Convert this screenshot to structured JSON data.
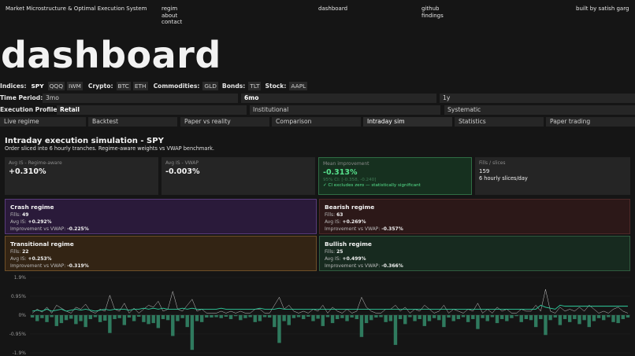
{
  "nav": {
    "site_title": "Market Microstructure & Optimal Execution System",
    "links_col1": [
      "regim",
      "about",
      "contact"
    ],
    "center": "dashboard",
    "links_col3": [
      "github",
      "findings"
    ],
    "credit": "built by satish garg"
  },
  "hero": "dashboard",
  "indices": {
    "label": "Indices:",
    "items": [
      "SPY",
      "QQQ",
      "IWM"
    ],
    "selected": "SPY",
    "crypto_label": "Crypto:",
    "crypto": [
      "BTC",
      "ETH"
    ],
    "commodities_label": "Commodities:",
    "commodities": [
      "GLD"
    ],
    "bonds_label": "Bonds:",
    "bonds": [
      "TLT"
    ],
    "stock_label": "Stock:",
    "stock": [
      "AAPL"
    ]
  },
  "time_period": {
    "label": "Time Period:",
    "options": [
      "3mo",
      "6mo",
      "1y"
    ],
    "selected": "6mo"
  },
  "execution_profile": {
    "label": "Execution Profile:",
    "options": [
      "Retail",
      "Institutional",
      "Systematic"
    ],
    "selected": "Retail"
  },
  "tabs": [
    "Live regime",
    "Backtest",
    "Paper vs reality",
    "Comparison",
    "Intraday sim",
    "Statistics",
    "Paper trading"
  ],
  "selected_tab": "Intraday sim",
  "section": {
    "title": "Intraday execution simulation - SPY",
    "subtitle": "Order sliced into 6 hourly tranches. Regime-aware weights vs VWAP benchmark."
  },
  "cards": {
    "c1": {
      "k": "Avg IS - Regime-aware",
      "v": "+0.310%"
    },
    "c2": {
      "k": "Avg IS - VWAP",
      "v": "-0.003%"
    },
    "c3": {
      "k": "Mean improvement",
      "v": "-0.313%",
      "ci": "95% CI: [-0.358, -0.240]",
      "sig": "✓ CI excludes zero — statistically significant"
    },
    "c4": {
      "k": "Fills / slices",
      "v": "159",
      "s": "6 hourly slices/day"
    }
  },
  "regimes": {
    "crash": {
      "title": "Crash regime",
      "fills_label": "Fills:",
      "fills": "49",
      "avg_label": "Avg IS:",
      "avg": "+0.292%",
      "imp_label": "Improvement vs VWAP:",
      "imp": "-0.225%"
    },
    "bear": {
      "title": "Bearish regime",
      "fills_label": "Fills:",
      "fills": "63",
      "avg_label": "Avg IS:",
      "avg": "+0.269%",
      "imp_label": "Improvement vs VWAP:",
      "imp": "-0.357%"
    },
    "trans": {
      "title": "Transitional regime",
      "fills_label": "Fills:",
      "fills": "22",
      "avg_label": "Avg IS:",
      "avg": "+0.253%",
      "imp_label": "Improvement vs VWAP:",
      "imp": "-0.319%"
    },
    "bull": {
      "title": "Bullish regime",
      "fills_label": "Fills:",
      "fills": "25",
      "avg_label": "Avg IS:",
      "avg": "+0.499%",
      "imp_label": "Improvement vs VWAP:",
      "imp": "-0.366%"
    }
  },
  "colors": {
    "bar": "#2f7a5e",
    "line": "#2fd0a0",
    "thin": "#c8c8c8"
  },
  "chart_data": {
    "type": "bar",
    "ytick_labels": [
      "1.9%",
      "0.95%",
      "0%",
      "-0.95%",
      "-1.9%"
    ],
    "yticks": [
      1.9,
      0.95,
      0,
      -0.95,
      -1.9
    ],
    "ylim": [
      -1.9,
      1.9
    ],
    "series": [
      {
        "values": [
          -0.12,
          -0.3,
          -0.15,
          -0.35,
          -0.1,
          -0.55,
          -0.4,
          -0.25,
          -0.18,
          -0.45,
          -0.3,
          -0.6,
          -0.2,
          -0.1,
          -0.35,
          -0.28,
          -0.9,
          -0.2,
          -0.15,
          -0.5,
          -0.12,
          -0.3,
          -0.08,
          -0.35,
          -0.45,
          -0.4,
          -0.65,
          -0.2,
          -0.25,
          -1.05,
          -0.3,
          -0.15,
          -0.6,
          -1.75,
          -0.3,
          -0.35,
          -0.12,
          -0.12,
          -0.1,
          -0.15,
          -0.08,
          -0.2,
          -0.05,
          -0.25,
          -0.15,
          -0.1,
          -0.35,
          -0.3,
          -0.1,
          -0.12,
          -0.6,
          -1.4,
          -0.3,
          -0.5,
          -0.15,
          -0.1,
          -0.2,
          -0.08,
          -0.3,
          -0.18,
          -0.55,
          -0.1,
          -0.4,
          -0.2,
          -0.15,
          -0.3,
          -0.12,
          -0.2,
          -1.1,
          -0.4,
          -0.25,
          -0.12,
          -0.1,
          -0.35,
          -0.3,
          -1.5,
          -0.2,
          -0.45,
          -0.1,
          -0.3,
          -0.2,
          -0.55,
          -0.3,
          -0.15,
          -0.25,
          -0.6,
          -0.12,
          -0.3,
          -0.2,
          -0.1,
          -0.35,
          -0.2,
          -0.7,
          -0.15,
          -0.3,
          -0.1,
          -0.4,
          -0.2,
          -0.3,
          -0.15,
          -0.05,
          -0.35,
          -0.2,
          -0.25,
          -0.6,
          -0.2,
          -1.0,
          -0.25,
          -0.12,
          -0.5,
          -0.2,
          -0.35,
          -0.2,
          -0.45,
          -0.25,
          -0.6,
          -0.3,
          -0.15,
          -0.25,
          -0.1,
          -0.35,
          -0.4,
          -0.2,
          -0.12
        ]
      }
    ],
    "line": [
      0.2,
      0.25,
      0.2,
      0.3,
      0.2,
      0.25,
      0.3,
      0.2,
      0.25,
      0.3,
      0.25,
      0.3,
      0.25,
      0.2,
      0.25,
      0.3,
      0.25,
      0.3,
      0.3,
      0.3,
      0.25,
      0.3,
      0.3,
      0.35,
      0.3,
      0.35,
      0.3,
      0.35,
      0.3,
      0.3,
      0.3,
      0.35,
      0.3,
      0.35,
      0.3,
      0.3,
      0.3,
      0.3,
      0.3,
      0.35,
      0.3,
      0.3,
      0.3,
      0.3,
      0.3,
      0.3,
      0.3,
      0.35,
      0.3,
      0.3,
      0.3,
      0.35,
      0.3,
      0.3,
      0.3,
      0.3,
      0.3,
      0.3,
      0.3,
      0.3,
      0.3,
      0.3,
      0.3,
      0.3,
      0.3,
      0.3,
      0.3,
      0.3,
      0.3,
      0.3,
      0.3,
      0.3,
      0.3,
      0.3,
      0.3,
      0.3,
      0.3,
      0.3,
      0.3,
      0.3,
      0.3,
      0.3,
      0.3,
      0.3,
      0.3,
      0.3,
      0.3,
      0.3,
      0.3,
      0.3,
      0.3,
      0.3,
      0.3,
      0.3,
      0.3,
      0.3,
      0.3,
      0.3,
      0.3,
      0.3,
      0.3,
      0.3,
      0.3,
      0.3,
      0.3,
      0.5,
      0.4,
      0.35,
      0.3,
      0.5,
      0.45,
      0.45,
      0.45,
      0.45,
      0.45,
      0.45,
      0.45,
      0.45,
      0.45,
      0.45,
      0.45,
      0.45,
      0.45,
      0.45
    ],
    "thin": [
      0.1,
      0.3,
      0.15,
      0.4,
      0.1,
      0.5,
      0.35,
      0.2,
      0.1,
      0.4,
      0.3,
      0.55,
      0.2,
      0.1,
      0.3,
      0.2,
      1.0,
      0.3,
      0.2,
      0.6,
      0.1,
      0.35,
      0.1,
      0.3,
      0.5,
      0.4,
      0.7,
      0.2,
      0.3,
      1.2,
      0.3,
      0.2,
      0.5,
      0.8,
      0.2,
      0.3,
      0.1,
      0.1,
      0.1,
      0.2,
      0.1,
      0.2,
      0.1,
      0.2,
      0.1,
      0.1,
      0.3,
      0.3,
      0.1,
      0.1,
      0.5,
      0.9,
      0.3,
      0.5,
      0.2,
      0.1,
      0.2,
      0.1,
      0.3,
      0.2,
      0.5,
      0.1,
      0.4,
      0.2,
      0.1,
      0.3,
      0.1,
      0.2,
      0.9,
      0.4,
      0.2,
      0.1,
      0.1,
      0.3,
      0.3,
      0.5,
      0.2,
      0.4,
      0.1,
      0.3,
      0.2,
      0.5,
      0.3,
      0.1,
      0.2,
      0.5,
      0.1,
      0.3,
      0.2,
      0.1,
      0.3,
      0.2,
      0.6,
      0.1,
      0.3,
      0.1,
      0.4,
      0.2,
      0.3,
      0.1,
      0.1,
      0.3,
      0.2,
      0.2,
      0.5,
      0.2,
      1.3,
      0.2,
      0.1,
      0.4,
      0.2,
      0.3,
      0.2,
      0.4,
      0.2,
      0.5,
      0.3,
      0.1,
      0.2,
      0.1,
      0.3,
      0.4,
      0.2,
      0.1
    ]
  }
}
